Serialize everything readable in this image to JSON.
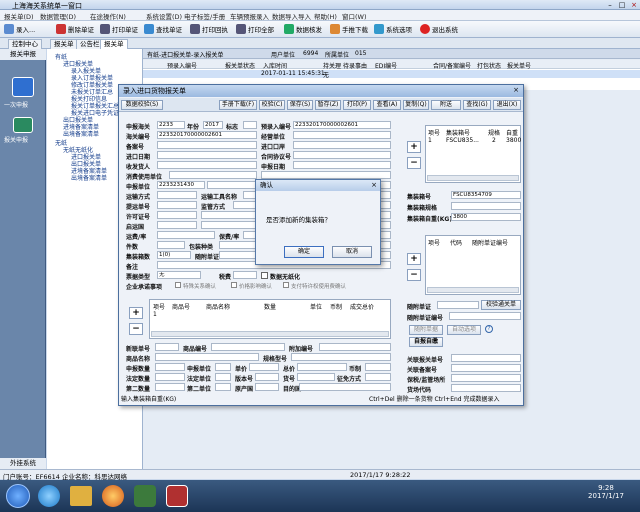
{
  "app": {
    "title": "上海海关系统单一窗口"
  },
  "menu": [
    "报关单(D)",
    "数据管理(D)",
    "在途操作(N)",
    "系统设置(D)",
    "电子标签/手册",
    "车辆预报录入",
    "数据导入导入",
    "帮助(H)",
    "窗口(W)"
  ],
  "toolbar": [
    "录入...",
    "删除单证",
    "打印单证",
    "查找单证",
    "打印回执",
    "打印全部",
    "数据核发",
    "手推下载",
    "系统选项",
    "退出系统"
  ],
  "tabs": [
    "控制中心",
    "报关单",
    "公告栏",
    "报关单"
  ],
  "sidebar": {
    "head": "报关申报",
    "items": [
      "一次申报",
      "报关申报"
    ],
    "foot": "外挂系统"
  },
  "tree": [
    "有纸",
    "进口报关单",
    "录入报关单",
    "录入订单报关单",
    "修改订单报关单",
    "未报关订单汇总",
    "报关打印信息",
    "报关订单报关汇总",
    "报关进口电子凭证",
    "出口报关单",
    "进境备案清单",
    "出境备案清单",
    "无纸",
    "无纸无纸化",
    "进口报关单",
    "出口报关单",
    "进境备案清单",
    "出境备案清单"
  ],
  "bgwin": {
    "title": "有纸-进口报关单-录入报关单",
    "user_label": "用户单位",
    "user_val": "6994",
    "dept_label": "所属单位",
    "dept_val": "015",
    "cols": [
      "预录入编号",
      "报关单状态",
      "入库时间",
      "持关理",
      "待录事由",
      "EDI编号",
      "合同/备案编号",
      "打包状态",
      "报关单号"
    ],
    "row": [
      "",
      "",
      "2017-01-11 15:45:31",
      "无",
      "",
      "",
      "",
      "",
      ""
    ]
  },
  "win": {
    "title": "录入进口货物报关单",
    "buttons": [
      "数据校验(S)",
      "手册下载(F)",
      "校验(C)",
      "保存(S)",
      "暂存(Z)",
      "打印(P)",
      "查看(A)",
      "复制(Q)",
      "附送",
      "查找(G)",
      "退出(X)"
    ],
    "left": {
      "rows": [
        {
          "l": "申报海关",
          "v": "2233",
          "l2": "年份",
          "v2": "2017",
          "l3": "标志",
          "v3": "",
          "l4": "预录入编号",
          "v4": "223320170000002601"
        },
        {
          "l": "海关编号",
          "v": "223320170000002601"
        },
        {
          "l": "备案号"
        },
        {
          "l": "进口日期"
        },
        {
          "l": "收发货人"
        },
        {
          "l": "消费使用单位"
        },
        {
          "l": "申报单位",
          "v": "2233231430"
        },
        {
          "l": "运输方式",
          "l2": "运输工具名称"
        },
        {
          "l": "提运单号",
          "l2": "监管方式"
        },
        {
          "l": "许可证号"
        },
        {
          "l": "启运国"
        },
        {
          "l": "运费/率",
          "l2": "保费/率"
        },
        {
          "l": "件数",
          "l2": "包装种类"
        },
        {
          "l": "集装箱数",
          "v": "1(0)",
          "l2": "随附单证"
        },
        {
          "l": "备注"
        }
      ],
      "right_labels": [
        "经营单位",
        "进口口岸",
        "合同协议号",
        "申报日期"
      ],
      "special_type": "票据类型",
      "special_sel": "无",
      "special_l2": "税费",
      "checkbox": "数据无纸化",
      "confirm": "企业承诺事项",
      "chk": [
        "特殊关系确认",
        "价格影响确认",
        "支付特许权使用费确认"
      ],
      "goods_cols": [
        "项号",
        "商品号",
        "商品名称",
        "数量",
        "单位",
        "币制",
        "成交总价"
      ],
      "goods_row": [
        "1",
        "",
        "",
        "",
        "",
        "",
        ""
      ],
      "bottom_labels": [
        "新联单号",
        "商品编号",
        "附加编号",
        "商品名称",
        "规格型号",
        "申报数量",
        "申报单位",
        "单价",
        "总价",
        "币制",
        "法定数量",
        "法定单位",
        "版本号",
        "货号",
        "征免方式",
        "第二数量",
        "第二单位",
        "原产国",
        "目的国",
        "用途/生产厂家"
      ],
      "hint": "输入集装箱自重(KG)"
    },
    "right": {
      "cols": [
        "项号",
        "集装箱号",
        "规格",
        "自重"
      ],
      "row": [
        "1",
        "FSCU835...",
        "2",
        "3800"
      ],
      "l": [
        "集装箱号",
        "集装箱规格",
        "集装箱自重(KG)"
      ],
      "v": [
        "FSCU8354709",
        "",
        "3800"
      ],
      "cols2": [
        "项号",
        "代码",
        "随附单证编号"
      ],
      "l2": [
        "随附单证",
        "随附单证编号"
      ],
      "btn": "校验通关单",
      "btns": [
        "随附单据",
        "自动选项",
        "自报自缴"
      ],
      "l3": [
        "关联报关单号",
        "关联备案号",
        "保税/监管场所",
        "货场代码"
      ]
    },
    "footer": "Ctrl+Del 删除一条货物 Ctrl+End 完成数据录入"
  },
  "dialog": {
    "title": "确认",
    "message": "是否添加新的集装箱？",
    "ok": "确定",
    "cancel": "取消"
  },
  "status": {
    "left": "门户账号：EF6614   企业名称：科思达网络",
    "time": "2017/1/17 9:28:22"
  },
  "taskbar": {
    "time": "9:28",
    "date": "2017/1/17"
  }
}
